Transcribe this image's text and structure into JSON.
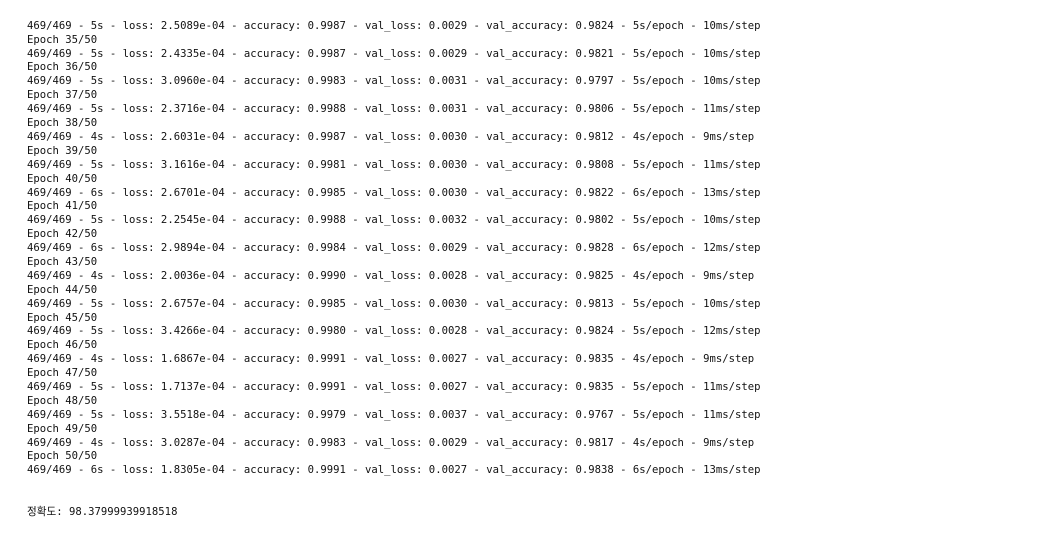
{
  "console": {
    "lines": [
      "469/469 - 5s - loss: 2.5089e-04 - accuracy: 0.9987 - val_loss: 0.0029 - val_accuracy: 0.9824 - 5s/epoch - 10ms/step",
      "Epoch 35/50",
      "469/469 - 5s - loss: 2.4335e-04 - accuracy: 0.9987 - val_loss: 0.0029 - val_accuracy: 0.9821 - 5s/epoch - 10ms/step",
      "Epoch 36/50",
      "469/469 - 5s - loss: 3.0960e-04 - accuracy: 0.9983 - val_loss: 0.0031 - val_accuracy: 0.9797 - 5s/epoch - 10ms/step",
      "Epoch 37/50",
      "469/469 - 5s - loss: 2.3716e-04 - accuracy: 0.9988 - val_loss: 0.0031 - val_accuracy: 0.9806 - 5s/epoch - 11ms/step",
      "Epoch 38/50",
      "469/469 - 4s - loss: 2.6031e-04 - accuracy: 0.9987 - val_loss: 0.0030 - val_accuracy: 0.9812 - 4s/epoch - 9ms/step",
      "Epoch 39/50",
      "469/469 - 5s - loss: 3.1616e-04 - accuracy: 0.9981 - val_loss: 0.0030 - val_accuracy: 0.9808 - 5s/epoch - 11ms/step",
      "Epoch 40/50",
      "469/469 - 6s - loss: 2.6701e-04 - accuracy: 0.9985 - val_loss: 0.0030 - val_accuracy: 0.9822 - 6s/epoch - 13ms/step",
      "Epoch 41/50",
      "469/469 - 5s - loss: 2.2545e-04 - accuracy: 0.9988 - val_loss: 0.0032 - val_accuracy: 0.9802 - 5s/epoch - 10ms/step",
      "Epoch 42/50",
      "469/469 - 6s - loss: 2.9894e-04 - accuracy: 0.9984 - val_loss: 0.0029 - val_accuracy: 0.9828 - 6s/epoch - 12ms/step",
      "Epoch 43/50",
      "469/469 - 4s - loss: 2.0036e-04 - accuracy: 0.9990 - val_loss: 0.0028 - val_accuracy: 0.9825 - 4s/epoch - 9ms/step",
      "Epoch 44/50",
      "469/469 - 5s - loss: 2.6757e-04 - accuracy: 0.9985 - val_loss: 0.0030 - val_accuracy: 0.9813 - 5s/epoch - 10ms/step",
      "Epoch 45/50",
      "469/469 - 5s - loss: 3.4266e-04 - accuracy: 0.9980 - val_loss: 0.0028 - val_accuracy: 0.9824 - 5s/epoch - 12ms/step",
      "Epoch 46/50",
      "469/469 - 4s - loss: 1.6867e-04 - accuracy: 0.9991 - val_loss: 0.0027 - val_accuracy: 0.9835 - 4s/epoch - 9ms/step",
      "Epoch 47/50",
      "469/469 - 5s - loss: 1.7137e-04 - accuracy: 0.9991 - val_loss: 0.0027 - val_accuracy: 0.9835 - 5s/epoch - 11ms/step",
      "Epoch 48/50",
      "469/469 - 5s - loss: 3.5518e-04 - accuracy: 0.9979 - val_loss: 0.0037 - val_accuracy: 0.9767 - 5s/epoch - 11ms/step",
      "Epoch 49/50",
      "469/469 - 4s - loss: 3.0287e-04 - accuracy: 0.9983 - val_loss: 0.0029 - val_accuracy: 0.9817 - 4s/epoch - 9ms/step",
      "Epoch 50/50",
      "469/469 - 6s - loss: 1.8305e-04 - accuracy: 0.9991 - val_loss: 0.0027 - val_accuracy: 0.9838 - 6s/epoch - 13ms/step"
    ],
    "result": {
      "label": "정확도:",
      "value": "98.37999939918518"
    }
  }
}
